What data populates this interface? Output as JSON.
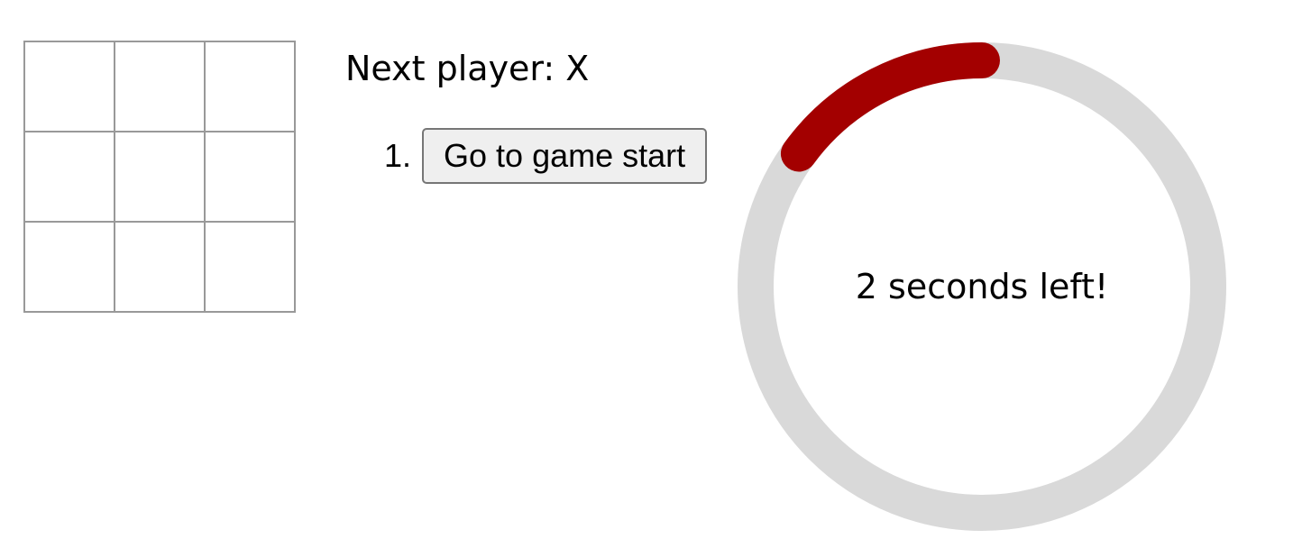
{
  "board": {
    "squares": [
      "",
      "",
      "",
      "",
      "",
      "",
      "",
      "",
      ""
    ]
  },
  "status": {
    "text": "Next player: X"
  },
  "moves": [
    {
      "number": "1.",
      "label": "Go to game start"
    }
  ],
  "timer": {
    "text": "2 seconds left!",
    "remaining_fraction": 0.15,
    "track_color": "#d9d9d9",
    "progress_color": "#a30000"
  }
}
